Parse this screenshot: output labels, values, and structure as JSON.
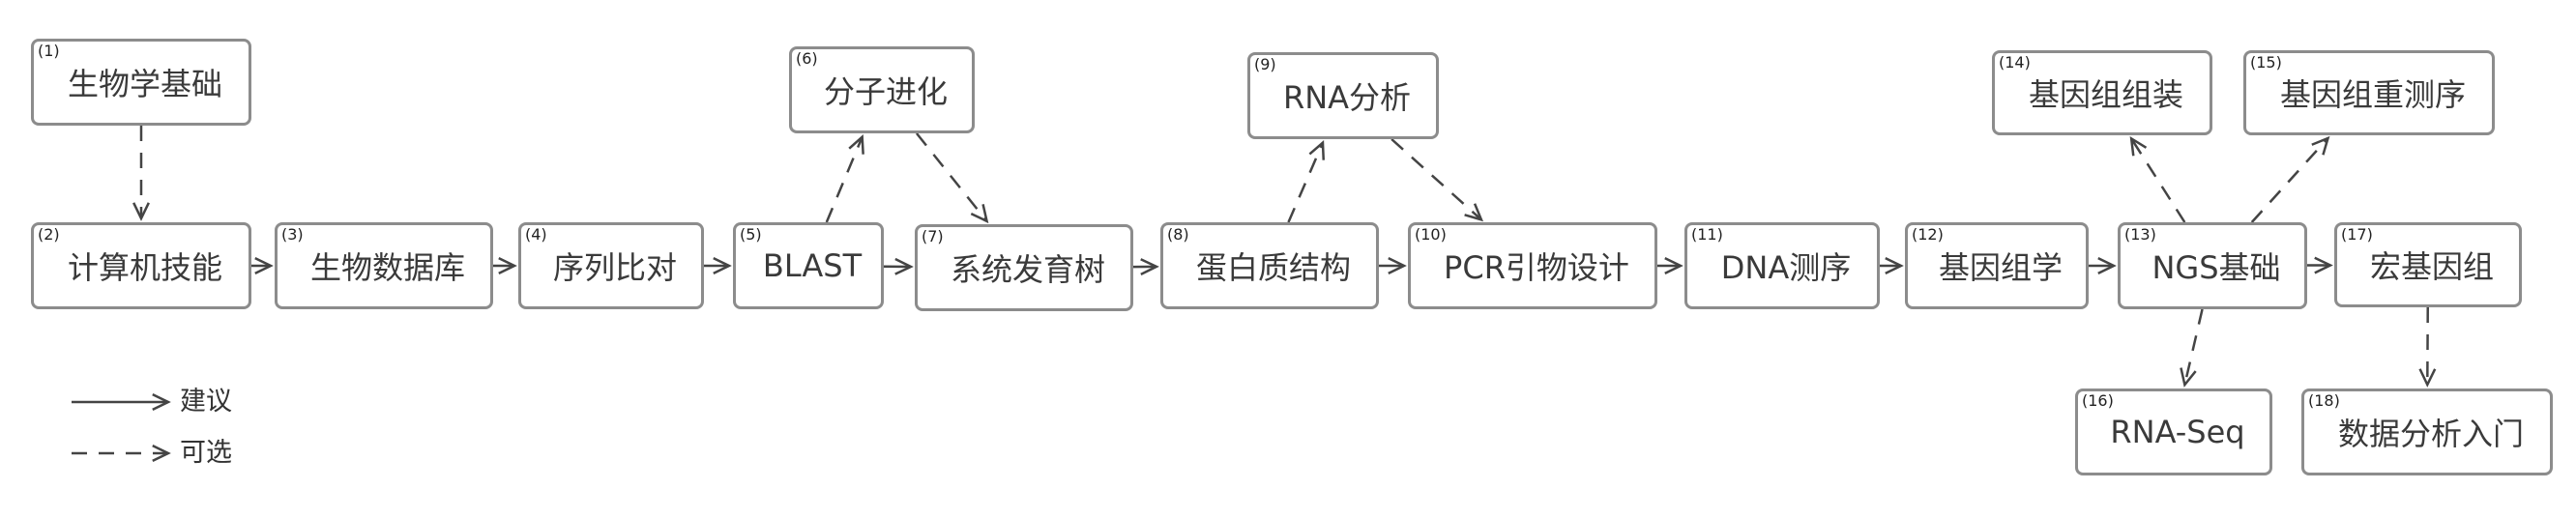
{
  "nodes": [
    {
      "id": "n1",
      "num": "(1)",
      "label": "生物学基础",
      "style": "green"
    },
    {
      "id": "n2",
      "num": "(2)",
      "label": "计算机技能",
      "style": "green"
    },
    {
      "id": "n3",
      "num": "(3)",
      "label": "生物数据库",
      "style": "gray"
    },
    {
      "id": "n4",
      "num": "(4)",
      "label": "序列比对",
      "style": "gray"
    },
    {
      "id": "n5",
      "num": "(5)",
      "label": "BLAST",
      "style": "gray"
    },
    {
      "id": "n6",
      "num": "(6)",
      "label": "分子进化",
      "style": "gray"
    },
    {
      "id": "n7",
      "num": "(7)",
      "label": "系统发育树",
      "style": "gray"
    },
    {
      "id": "n8",
      "num": "(8)",
      "label": "蛋白质结构",
      "style": "gray"
    },
    {
      "id": "n9",
      "num": "(9)",
      "label": "RNA分析",
      "style": "gray"
    },
    {
      "id": "n10",
      "num": "(10)",
      "label": "PCR引物设计",
      "style": "gray"
    },
    {
      "id": "n11",
      "num": "(11)",
      "label": "DNA测序",
      "style": "gray"
    },
    {
      "id": "n12",
      "num": "(12)",
      "label": "基因组学",
      "style": "gray"
    },
    {
      "id": "n13",
      "num": "(13)",
      "label": "NGS基础",
      "style": "blue"
    },
    {
      "id": "n14",
      "num": "(14)",
      "label": "基因组组装",
      "style": "blue"
    },
    {
      "id": "n15",
      "num": "(15)",
      "label": "基因组重测序",
      "style": "blue"
    },
    {
      "id": "n16",
      "num": "(16)",
      "label": "RNA-Seq",
      "style": "blue"
    },
    {
      "id": "n17",
      "num": "(17)",
      "label": "宏基因组",
      "style": "blue"
    },
    {
      "id": "n18",
      "num": "(18)",
      "label": "数据分析入门",
      "style": "green"
    }
  ],
  "edges": [
    {
      "from": "n1",
      "to": "n2",
      "kind": "optional"
    },
    {
      "from": "n2",
      "to": "n3",
      "kind": "recommended"
    },
    {
      "from": "n3",
      "to": "n4",
      "kind": "recommended"
    },
    {
      "from": "n4",
      "to": "n5",
      "kind": "recommended"
    },
    {
      "from": "n5",
      "to": "n6",
      "kind": "optional"
    },
    {
      "from": "n6",
      "to": "n7",
      "kind": "optional"
    },
    {
      "from": "n5",
      "to": "n7",
      "kind": "recommended"
    },
    {
      "from": "n7",
      "to": "n8",
      "kind": "recommended"
    },
    {
      "from": "n8",
      "to": "n9",
      "kind": "optional"
    },
    {
      "from": "n9",
      "to": "n10",
      "kind": "optional"
    },
    {
      "from": "n8",
      "to": "n10",
      "kind": "recommended"
    },
    {
      "from": "n10",
      "to": "n11",
      "kind": "recommended"
    },
    {
      "from": "n11",
      "to": "n12",
      "kind": "recommended"
    },
    {
      "from": "n12",
      "to": "n13",
      "kind": "recommended"
    },
    {
      "from": "n13",
      "to": "n14",
      "kind": "optional"
    },
    {
      "from": "n13",
      "to": "n15",
      "kind": "optional"
    },
    {
      "from": "n13",
      "to": "n16",
      "kind": "optional"
    },
    {
      "from": "n13",
      "to": "n17",
      "kind": "recommended"
    },
    {
      "from": "n17",
      "to": "n18",
      "kind": "optional"
    }
  ],
  "legend": {
    "recommended": "建议",
    "optional": "可选"
  },
  "colors": {
    "box_default": "#8c8c8c",
    "box_green": "#7cc04e",
    "box_blue": "#a8cbef",
    "line": "#444444"
  }
}
